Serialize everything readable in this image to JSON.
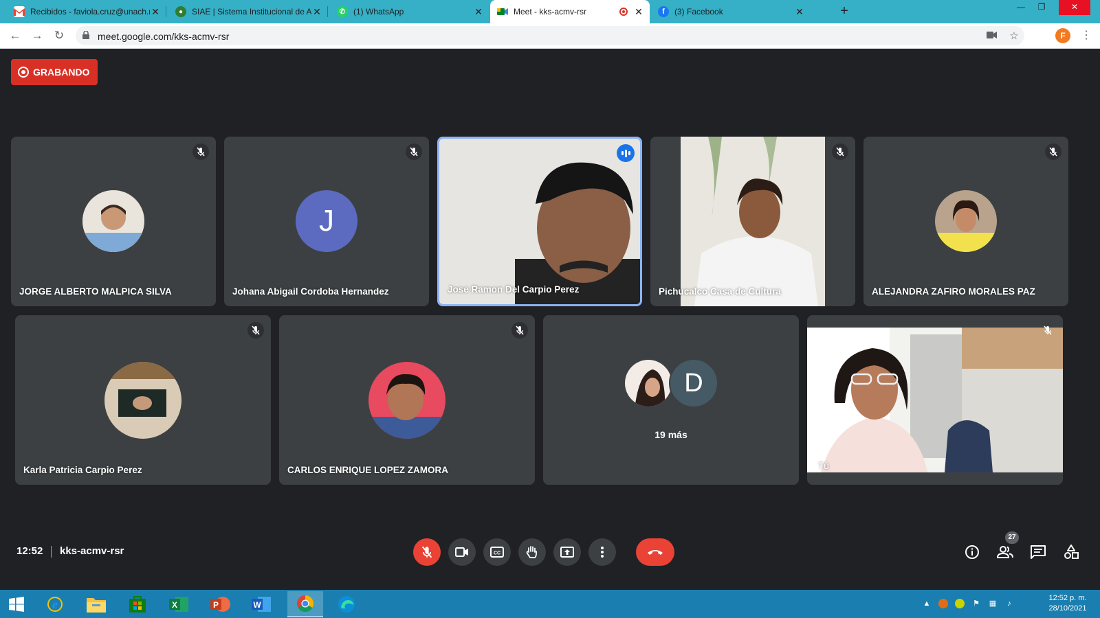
{
  "browser": {
    "tabs": [
      {
        "title": "Recibidos - faviola.cruz@unach.m",
        "icon": "gmail-icon",
        "color": "#ea4335"
      },
      {
        "title": "SIAE | Sistema Institucional de Ac",
        "icon": "siae-icon",
        "color": "#2e7d32"
      },
      {
        "title": "(1) WhatsApp",
        "icon": "whatsapp-icon",
        "color": "#25d366"
      },
      {
        "title": "Meet - kks-acmv-rsr",
        "icon": "meet-icon",
        "color": "#00832d"
      },
      {
        "title": "(3) Facebook",
        "icon": "facebook-icon",
        "color": "#1877f2"
      }
    ],
    "new_tab": "+",
    "url": "meet.google.com/kks-acmv-rsr",
    "profile_initial": "F"
  },
  "meet": {
    "recording_label": "GRABANDO",
    "participants": [
      {
        "name": "JORGE ALBERTO MALPICA SILVA",
        "muted": true
      },
      {
        "name": "Johana Abigail Cordoba Hernandez",
        "muted": true,
        "avatar_letter": "J"
      },
      {
        "name": "Jose Ramon Del Carpio Perez",
        "muted": false,
        "speaking": true
      },
      {
        "name": "Pichucalco Casa de Cultura",
        "muted": true
      },
      {
        "name": "ALEJANDRA ZAFIRO MORALES PAZ",
        "muted": true
      },
      {
        "name": "Karla Patricia Carpio Perez",
        "muted": true
      },
      {
        "name": "CARLOS ENRIQUE LOPEZ ZAMORA",
        "muted": true
      }
    ],
    "more": {
      "avatar_letter": "D",
      "label": "19 más"
    },
    "self": {
      "name": "Tú",
      "muted": true
    },
    "time": "12:52",
    "meeting_code": "kks-acmv-rsr",
    "people_count": "27",
    "colors": {
      "recording": "#d93025",
      "hangup": "#ea4335",
      "speaking": "#1a73e8",
      "avatar_j": "#5c6bc0",
      "avatar_d": "#455a64"
    }
  },
  "taskbar": {
    "apps": [
      "windows-start-icon",
      "internet-explorer-icon",
      "file-explorer-icon",
      "store-icon",
      "excel-icon",
      "powerpoint-icon",
      "word-icon",
      "chrome-icon",
      "edge-icon"
    ],
    "time": "12:52 p. m.",
    "date": "28/10/2021"
  }
}
